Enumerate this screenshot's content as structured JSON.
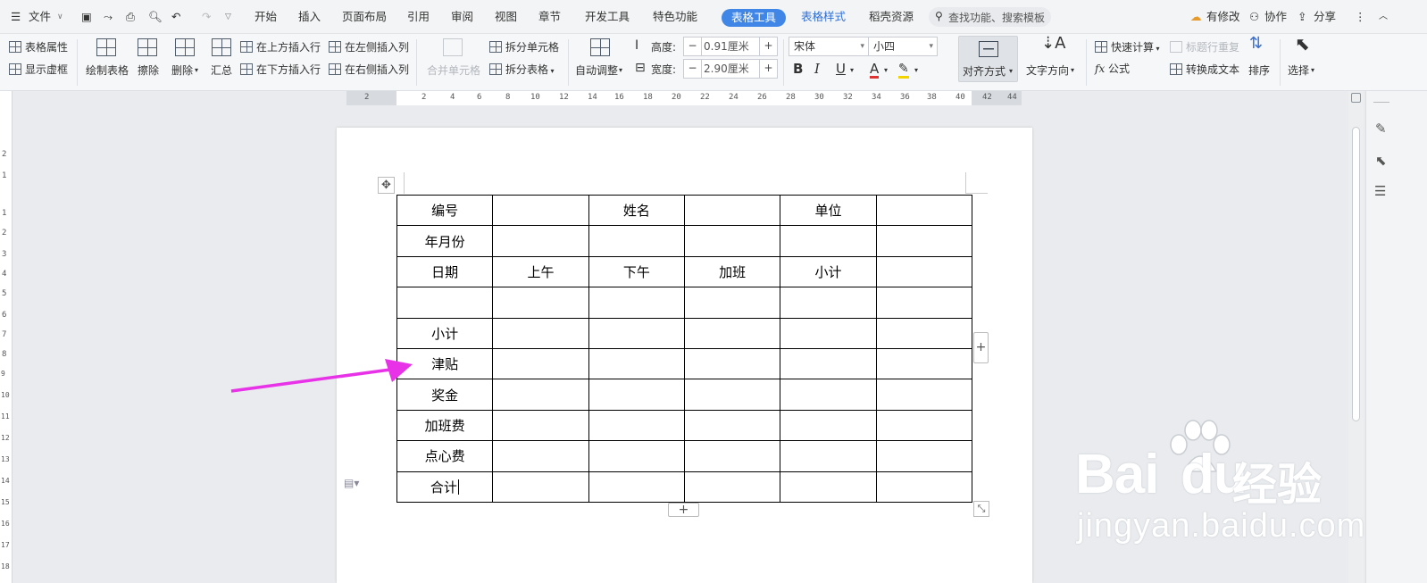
{
  "menubar": {
    "file": "文件",
    "tabs": [
      "开始",
      "插入",
      "页面布局",
      "引用",
      "审阅",
      "视图",
      "章节",
      "开发工具",
      "特色功能",
      "表格工具",
      "表格样式",
      "稻壳资源"
    ],
    "active_tab": "表格工具",
    "search_placeholder": "查找功能、搜索模板",
    "modified": "有修改",
    "collab": "协作",
    "share": "分享"
  },
  "ribbon": {
    "table_props": "表格属性",
    "show_grid": "显示虚框",
    "draw_table": "绘制表格",
    "erase": "擦除",
    "delete": "删除",
    "summary": "汇总",
    "insert_above": "在上方插入行",
    "insert_below": "在下方插入行",
    "insert_left": "在左侧插入列",
    "insert_right": "在右侧插入列",
    "merge_cells": "合并单元格",
    "split_cells": "拆分单元格",
    "split_table": "拆分表格",
    "auto_fit": "自动调整",
    "height_label": "高度:",
    "height_value": "0.91厘米",
    "width_label": "宽度:",
    "width_value": "2.90厘米",
    "font_name": "宋体",
    "font_size": "小四",
    "align": "对齐方式",
    "text_dir": "文字方向",
    "quick_calc": "快速计算",
    "formula": "公式",
    "repeat_header": "标题行重复",
    "to_text": "转换成文本",
    "sort": "排序",
    "select": "选择"
  },
  "ruler": {
    "ticks": [
      "2",
      "2",
      "4",
      "6",
      "8",
      "10",
      "12",
      "14",
      "16",
      "18",
      "20",
      "22",
      "24",
      "26",
      "28",
      "30",
      "32",
      "34",
      "36",
      "38",
      "40",
      "42",
      "44"
    ]
  },
  "vruler": {
    "ticks": [
      "2",
      "1",
      "1",
      "2",
      "3",
      "4",
      "5",
      "6",
      "7",
      "8",
      "9",
      "10",
      "11",
      "12",
      "13",
      "14",
      "15",
      "16",
      "17",
      "18"
    ]
  },
  "table": {
    "rows": [
      [
        "编号",
        "",
        "姓名",
        "",
        "单位",
        ""
      ],
      [
        "年月份",
        "",
        "",
        "",
        "",
        ""
      ],
      [
        "日期",
        "上午",
        "下午",
        "加班",
        "小计",
        ""
      ],
      [
        "",
        "",
        "",
        "",
        "",
        ""
      ],
      [
        "小计",
        "",
        "",
        "",
        "",
        ""
      ],
      [
        "津贴",
        "",
        "",
        "",
        "",
        ""
      ],
      [
        "奖金",
        "",
        "",
        "",
        "",
        ""
      ],
      [
        "加班费",
        "",
        "",
        "",
        "",
        ""
      ],
      [
        "点心费",
        "",
        "",
        "",
        "",
        ""
      ],
      [
        "合计",
        "",
        "",
        "",
        "",
        ""
      ]
    ]
  },
  "annotation": {
    "arrow_color": "#e832e8"
  },
  "watermark": {
    "brand": "Bai",
    "brand2": "du",
    "cn": "经验",
    "url": "jingyan.baidu.com"
  },
  "colors": {
    "accent": "#3f86e6",
    "arrow": "#e832e8"
  }
}
